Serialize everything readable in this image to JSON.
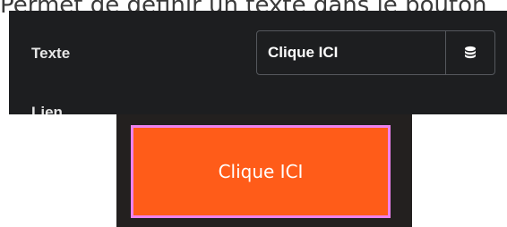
{
  "top_text": "Permet de définir un texte dans le bouton",
  "editor": {
    "text_field": {
      "label": "Texte",
      "value": "Clique ICI"
    },
    "dynamic_data_icon": "database-icon",
    "next_field": {
      "label": "Lien"
    }
  },
  "preview": {
    "button_label": "Clique ICI",
    "button_color": "#ff5c19",
    "outline_color": "#ee82ee"
  }
}
